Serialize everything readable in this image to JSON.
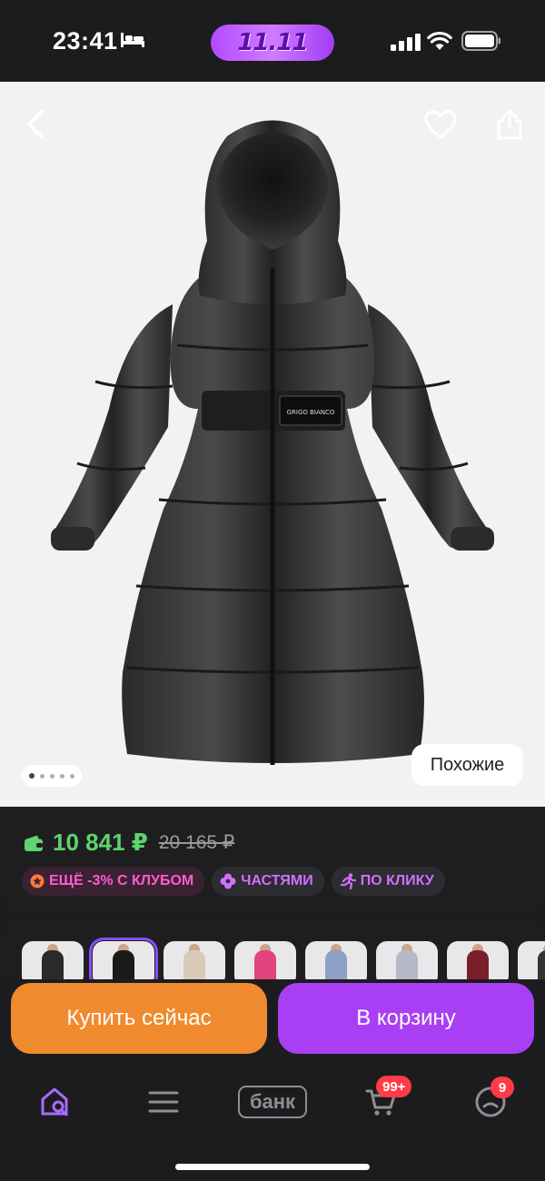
{
  "status_bar": {
    "time": "23:41",
    "promo": "11.11"
  },
  "product_image": {
    "similar_label": "Похожие",
    "photo_count": 5,
    "current_photo": 1,
    "belt_text": "GRIGO BIANCO"
  },
  "price": {
    "current": "10 841 ₽",
    "old": "20 165 ₽",
    "color_current": "#5dd46d"
  },
  "badges": [
    {
      "label": "ЕЩЁ -3% С КЛУБОМ",
      "icon": "club-icon"
    },
    {
      "label": "ЧАСТЯМИ",
      "icon": "installments-icon"
    },
    {
      "label": "ПО КЛИКУ",
      "icon": "runner-icon"
    }
  ],
  "actions": {
    "buy_now": "Купить сейчас",
    "add_to_cart": "В корзину",
    "buy_color": "#f08a2e",
    "cart_color": "#a93ff5"
  },
  "nav": {
    "bank_label": "банк",
    "cart_badge": "99+",
    "profile_badge": "9"
  }
}
